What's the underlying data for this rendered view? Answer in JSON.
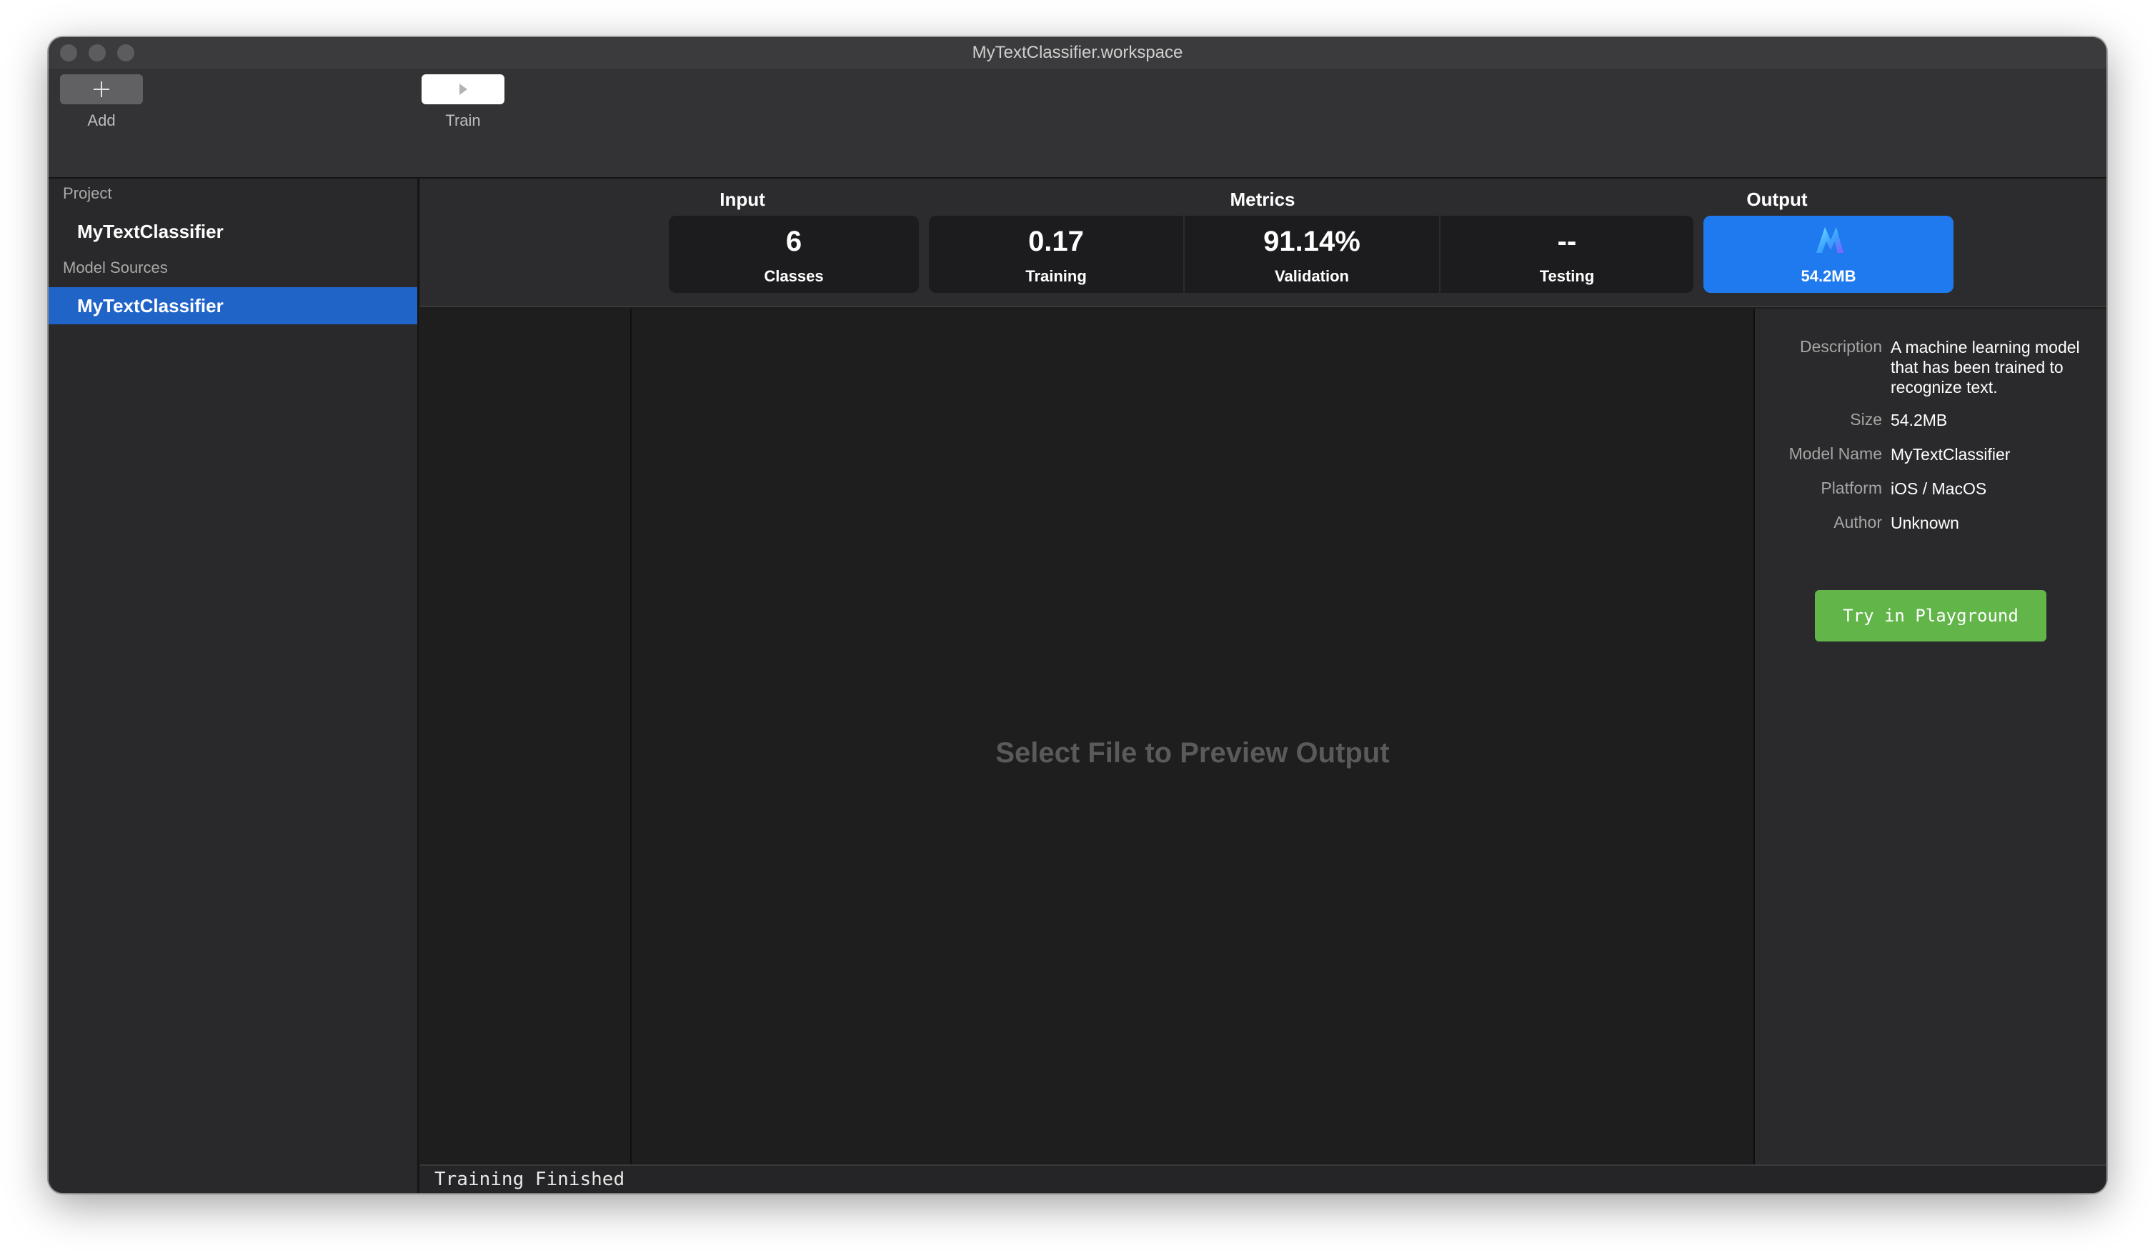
{
  "window": {
    "title": "MyTextClassifier.workspace"
  },
  "toolbar": {
    "add_label": "Add",
    "train_label": "Train"
  },
  "sidebar": {
    "project_header": "Project",
    "project_item": "MyTextClassifier",
    "sources_header": "Model Sources",
    "sources_item": "MyTextClassifier"
  },
  "metrics": {
    "input_label": "Input",
    "metrics_label": "Metrics",
    "output_label": "Output",
    "classes": {
      "value": "6",
      "label": "Classes"
    },
    "training": {
      "value": "0.17",
      "label": "Training"
    },
    "validation": {
      "value": "91.14%",
      "label": "Validation"
    },
    "testing": {
      "value": "--",
      "label": "Testing"
    },
    "output": {
      "size": "54.2MB"
    }
  },
  "preview": {
    "placeholder": "Select File to Preview Output"
  },
  "details": {
    "description_key": "Description",
    "description_val": "A machine learning model that has been trained to recognize text.",
    "size_key": "Size",
    "size_val": "54.2MB",
    "model_name_key": "Model Name",
    "model_name_val": "MyTextClassifier",
    "platform_key": "Platform",
    "platform_val": "iOS / MacOS",
    "author_key": "Author",
    "author_val": "Unknown",
    "playground_button": "Try in Playground"
  },
  "status": {
    "text": "Training Finished"
  },
  "colors": {
    "accent_blue": "#1f7af0",
    "selection_blue": "#2064c8",
    "playground_green": "#62b549"
  },
  "icons": {
    "add": "plus-icon",
    "train": "play-icon",
    "output_model": "model-icon"
  }
}
